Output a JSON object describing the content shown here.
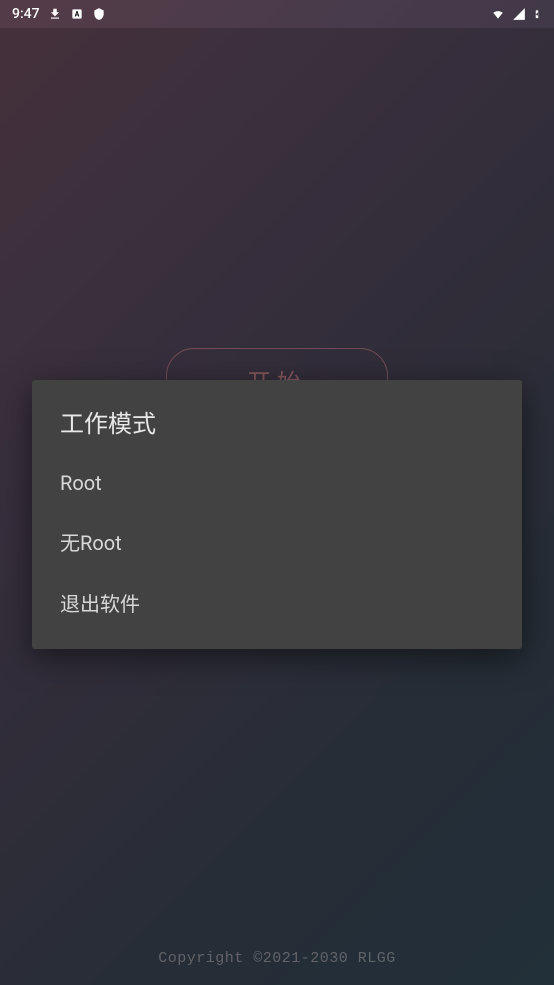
{
  "status_bar": {
    "time": "9:47",
    "download_icon": "download",
    "app_icon": "app-badge",
    "shield_icon": "shield",
    "wifi_icon": "wifi",
    "signal_icon": "signal",
    "battery_icon": "battery"
  },
  "main": {
    "start_button_label": "开始",
    "copyright_text": "Copyright ©2021-2030 RLGG"
  },
  "dialog": {
    "title": "工作模式",
    "options": [
      {
        "label": "Root"
      },
      {
        "label": "无Root"
      },
      {
        "label": "退出软件"
      }
    ]
  }
}
